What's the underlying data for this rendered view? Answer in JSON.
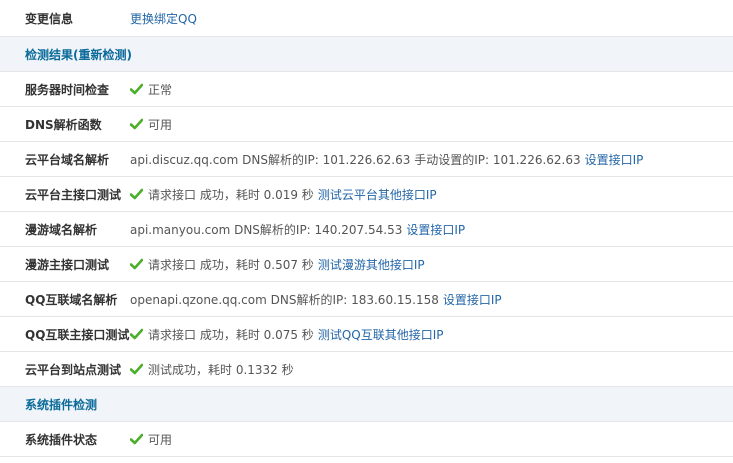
{
  "rows": {
    "change_info": {
      "label": "变更信息",
      "link": "更换绑定QQ"
    },
    "detect_section": {
      "title": "检测结果(重新检测)"
    },
    "server_time": {
      "label": "服务器时间检查",
      "status": "正常"
    },
    "dns_func": {
      "label": "DNS解析函数",
      "status": "可用"
    },
    "cloud_domain": {
      "label": "云平台域名解析",
      "text": "api.discuz.qq.com DNS解析的IP: 101.226.62.63 手动设置的IP: 101.226.62.63",
      "link": "设置接口IP"
    },
    "cloud_api": {
      "label": "云平台主接口测试",
      "text": "请求接口 成功，耗时 0.019 秒",
      "link": "测试云平台其他接口IP"
    },
    "manyou_domain": {
      "label": "漫游域名解析",
      "text": "api.manyou.com DNS解析的IP: 140.207.54.53",
      "link": "设置接口IP"
    },
    "manyou_api": {
      "label": "漫游主接口测试",
      "text": "请求接口 成功，耗时 0.507 秒",
      "link": "测试漫游其他接口IP"
    },
    "qq_domain": {
      "label": "QQ互联域名解析",
      "text": "openapi.qzone.qq.com DNS解析的IP: 183.60.15.158",
      "link": "设置接口IP"
    },
    "qq_api": {
      "label": "QQ互联主接口测试",
      "text": "请求接口 成功，耗时 0.075 秒",
      "link": "测试QQ互联其他接口IP"
    },
    "cloud_site": {
      "label": "云平台到站点测试",
      "text": "测试成功，耗时 0.1332 秒"
    },
    "plugin_section": {
      "title": "系统插件检测"
    },
    "plugin_status": {
      "label": "系统插件状态",
      "status": "可用"
    }
  },
  "icons": {
    "check": "check-icon"
  },
  "colors": {
    "check": "#4caf2a",
    "link": "#2366a8",
    "section_title": "#0b6b9a",
    "section_bg": "#f1f5fa"
  }
}
